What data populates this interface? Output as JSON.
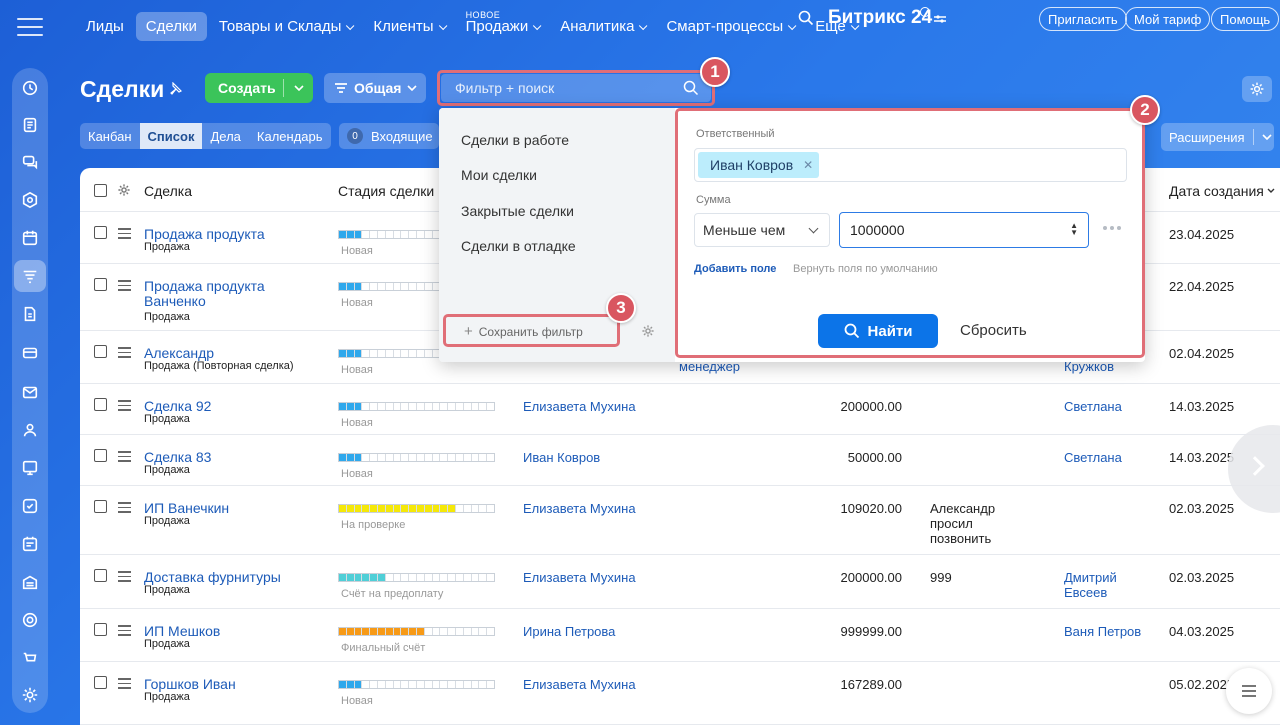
{
  "nav": {
    "items": [
      {
        "label": "Лиды",
        "chevron": false,
        "active": false
      },
      {
        "label": "Сделки",
        "chevron": false,
        "active": true
      },
      {
        "label": "Товары и Склады",
        "chevron": true,
        "active": false
      },
      {
        "label": "Клиенты",
        "chevron": true,
        "active": false
      },
      {
        "label": "Продажи",
        "chevron": true,
        "active": false,
        "badge": "НОВОЕ"
      },
      {
        "label": "Аналитика",
        "chevron": true,
        "active": false
      },
      {
        "label": "Смарт-процессы",
        "chevron": true,
        "active": false
      },
      {
        "label": "Еще",
        "chevron": true,
        "active": false
      }
    ],
    "brand": "Битрикс 24",
    "invite_label": "Пригласить",
    "tariff_label": "Мой тариф",
    "help_label": "Помощь"
  },
  "header": {
    "title": "Сделки",
    "create_label": "Создать",
    "preset_label": "Общая",
    "filter_placeholder": "Фильтр + поиск"
  },
  "views": {
    "tabs": [
      "Канбан",
      "Список",
      "Дела",
      "Календарь"
    ],
    "active": "Список",
    "incoming_count": "0",
    "incoming_label": "Входящие",
    "extensions_label": "Расширения"
  },
  "table": {
    "headers": {
      "deal": "Сделка",
      "stage": "Стадия сделки",
      "created": "Дата создания"
    },
    "rows": [
      {
        "name": "Продажа продукта",
        "type": "Продажа",
        "stage": "Новая",
        "stage_color": "#2fa8ec",
        "filled": 3,
        "person": "",
        "amount": "",
        "comment": "",
        "responsible": "",
        "date": "23.04.2025"
      },
      {
        "name": "Продажа продукта Ванченко",
        "type": "Продажа",
        "stage": "Новая",
        "stage_color": "#2fa8ec",
        "filled": 3,
        "person": "",
        "amount": "",
        "comment": "",
        "responsible": "",
        "date": "22.04.2025"
      },
      {
        "name": "Александр",
        "type": "Продажа (Повторная сделка)",
        "stage": "Новая",
        "stage_color": "#2fa8ec",
        "filled": 3,
        "person": "",
        "amount": "",
        "comment": "",
        "responsible": "",
        "date": "02.04.2025"
      },
      {
        "name": "Сделка 92",
        "type": "Продажа",
        "stage": "Новая",
        "stage_color": "#2fa8ec",
        "filled": 3,
        "person": "Елизавета Мухина",
        "amount": "200000.00",
        "comment": "",
        "responsible": "Светлана",
        "date": "14.03.2025"
      },
      {
        "name": "Сделка 83",
        "type": "Продажа",
        "stage": "Новая",
        "stage_color": "#2fa8ec",
        "filled": 3,
        "person": "Иван Ковров",
        "amount": "50000.00",
        "comment": "",
        "responsible": "Светлана",
        "date": "14.03.2025"
      },
      {
        "name": "ИП Ванечкин",
        "type": "Продажа",
        "stage": "На проверке",
        "stage_color": "#f5e808",
        "filled": 15,
        "person": "Елизавета Мухина",
        "amount": "109020.00",
        "comment": "Александр просил позвонить",
        "responsible": "",
        "date": "02.03.2025"
      },
      {
        "name": "Доставка фурнитуры",
        "type": "Продажа",
        "stage": "Счёт на предоплату",
        "stage_color": "#4fcfd7",
        "filled": 6,
        "person": "Елизавета Мухина",
        "amount": "200000.00",
        "comment": "999",
        "responsible": "Дмитрий Евсеев",
        "date": "02.03.2025"
      },
      {
        "name": "ИП Мешков",
        "type": "Продажа",
        "stage": "Финальный счёт",
        "stage_color": "#f79a17",
        "filled": 11,
        "person": "Ирина Петрова",
        "amount": "999999.00",
        "comment": "",
        "responsible": "Ваня Петров",
        "date": "04.03.2025"
      },
      {
        "name": "Горшков Иван",
        "type": "Продажа",
        "stage": "Новая",
        "stage_color": "#2fa8ec",
        "filled": 3,
        "person": "Елизавета Мухина",
        "amount": "167289.00",
        "comment": "",
        "responsible": "",
        "date": "05.02.2025"
      }
    ],
    "partial": {
      "row3_col4": "менеджер",
      "row3_resp": "Кружков"
    }
  },
  "filter_popup": {
    "presets": [
      "Сделки в работе",
      "Мои сделки",
      "Закрытые сделки",
      "Сделки в отладке"
    ],
    "save_filter_label": "Сохранить фильтр",
    "responsible_label": "Ответственный",
    "responsible_tag": "Иван Ковров",
    "sum_label": "Сумма",
    "sum_operator": "Меньше чем",
    "sum_value": "1000000",
    "add_field_label": "Добавить поле",
    "restore_label": "Вернуть поля по умолчанию",
    "find_label": "Найти",
    "reset_label": "Сбросить"
  },
  "annotations": [
    "1",
    "2",
    "3"
  ],
  "colors": {
    "accent": "#0c74e8",
    "highlight": "#e06e77",
    "badge": "#d95660",
    "create": "#3bc45a"
  }
}
